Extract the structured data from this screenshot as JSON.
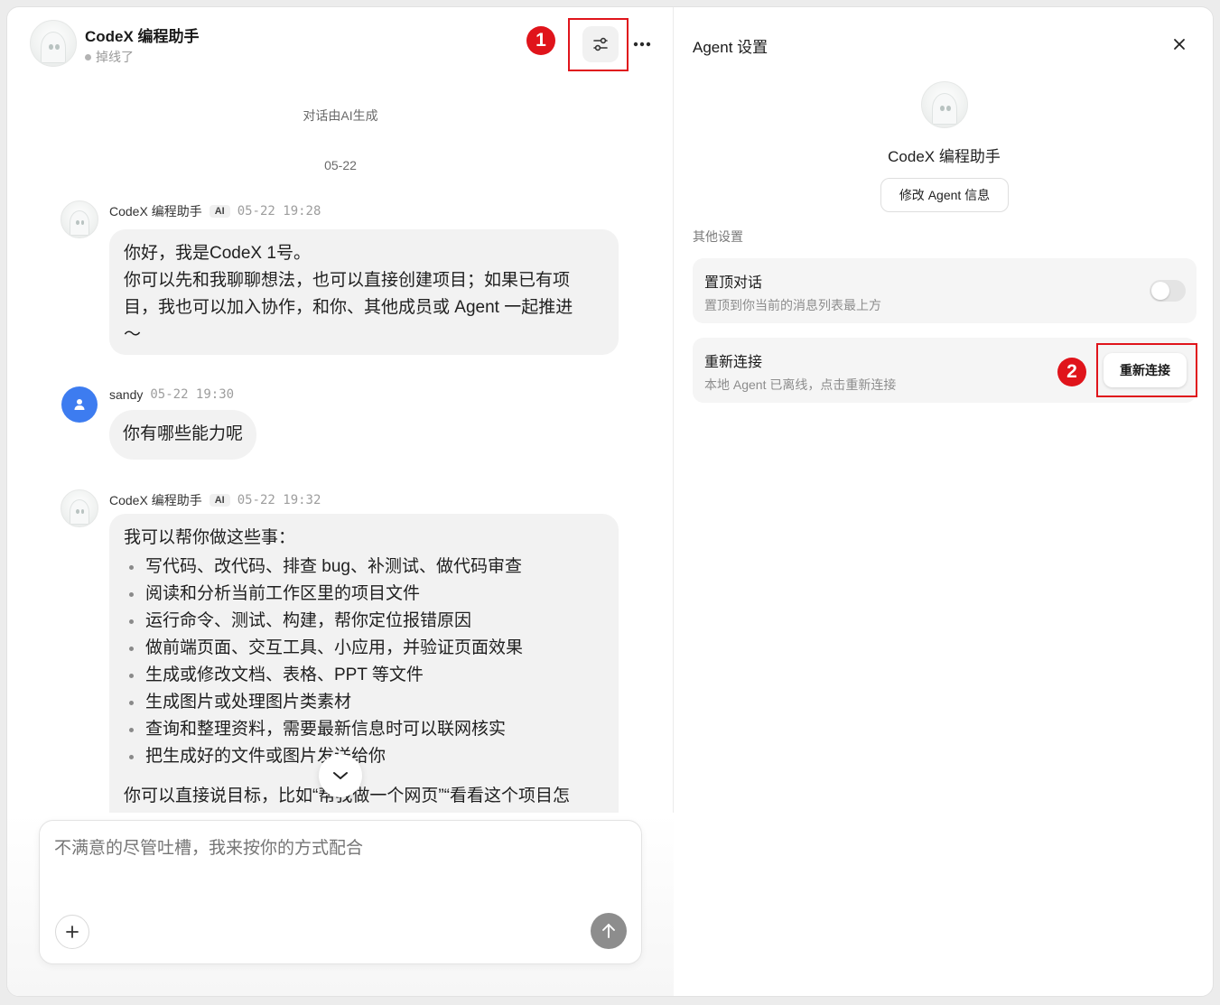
{
  "header": {
    "agent_name": "CodeX 编程助手",
    "status": "掉线了"
  },
  "markers": {
    "one": "1",
    "two": "2"
  },
  "chat": {
    "ai_generated_note": "对话由AI生成",
    "date_divider": "05-22",
    "ai_badge": "AI",
    "messages": [
      {
        "sender": "CodeX 编程助手",
        "time": "05-22 19:28",
        "lines": [
          "你好，我是CodeX 1号。",
          "你可以先和我聊聊想法，也可以直接创建项目；如果已有项",
          "目，我也可以加入协作，和你、其他成员或 Agent 一起推进",
          "～"
        ]
      },
      {
        "sender": "sandy",
        "time": "05-22 19:30",
        "text": "你有哪些能力呢"
      },
      {
        "sender": "CodeX 编程助手",
        "time": "05-22 19:32",
        "intro": "我可以帮你做这些事：",
        "items": [
          "写代码、改代码、排查 bug、补测试、做代码审查",
          "阅读和分析当前工作区里的项目文件",
          "运行命令、测试、构建，帮你定位报错原因",
          "做前端页面、交互工具、小应用，并验证页面效果",
          "生成或修改文档、表格、PPT 等文件",
          "生成图片或处理图片类素材",
          "查询和整理资料，需要最新信息时可以联网核实",
          "把生成好的文件或图片发送给你"
        ],
        "outro": "你可以直接说目标，比如“帮我做一个网页”“看看这个项目怎"
      }
    ]
  },
  "composer": {
    "placeholder": "不满意的尽管吐槽，我来按你的方式配合"
  },
  "settings": {
    "title": "Agent 设置",
    "agent_name": "CodeX 编程助手",
    "edit_button": "修改 Agent 信息",
    "section_label": "其他设置",
    "pin": {
      "title": "置顶对话",
      "subtitle": "置顶到你当前的消息列表最上方",
      "enabled": false
    },
    "reconnect": {
      "title": "重新连接",
      "subtitle": "本地 Agent 已离线，点击重新连接",
      "button": "重新连接"
    }
  },
  "colors": {
    "marker": "#e0141b",
    "user_avatar": "#3d7cf0",
    "bubble": "#f2f2f2"
  },
  "icons": [
    "ghost-avatar-icon",
    "settings-sliders-icon",
    "more-icon",
    "user-icon",
    "chevron-down-icon",
    "plus-icon",
    "arrow-up-icon",
    "close-icon"
  ]
}
